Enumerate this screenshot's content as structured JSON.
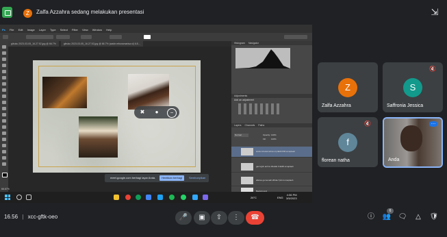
{
  "top_bar": {
    "presenter_initial": "Z",
    "presenter_text": "Zalfa Azzahra sedang melakukan presentasi",
    "collapse_icon": "collapse-icon"
  },
  "shared_screen": {
    "photoshop": {
      "menu": [
        "File",
        "Edit",
        "Image",
        "Layer",
        "Type",
        "Select",
        "Filter",
        "View",
        "Window",
        "Help"
      ],
      "tabs": [
        "gibuku 2023-03-05_16.27.52.jpg @ 66.7%",
        "gibuku 2023-03-05_16.27.52.jpg @ 66.7% (wade.rebussmarisa.sl) 6.8...",
        "gibuku 2023-03-05_16.27.52.jpg @ 66.7% (grade-rebussmarisa-sl) 6.8 CE OPP plaisle(f)... 2023-08-00"
      ],
      "zoom_readout": "66.67%",
      "panels": {
        "histogram_tabs": [
          "Histogram",
          "Navigator"
        ],
        "adjustments_title": "Adjustments",
        "adjustments_sub": "Add an adjustment",
        "layer_tabs": [
          "Layers",
          "Channels",
          "Paths"
        ],
        "blend_mode": "Normal",
        "opacity_label": "Opacity:",
        "opacity_value": "100%",
        "fill_label": "Fill:",
        "fill_value": "100%",
        "layers": [
          {
            "name": "anda rebussmarisa sl p4E4CNM.smaplaeb"
          },
          {
            "name": "gamvgzk anhra 1DeEE.7cE3M.smaplaeb"
          },
          {
            "name": "allarsa gumenadi sB4aL7p4mt.smaplaeb"
          },
          {
            "name": "Background"
          }
        ]
      }
    },
    "notification": {
      "text": "meet.google.com berbagi layar Anda.",
      "stop_button": "Hentikan berbagi",
      "hide_link": "Sembunyikan"
    },
    "taskbar": {
      "weather": "26°C",
      "lang": "ENG",
      "time": "4:36 PM",
      "date": "3/5/2023"
    }
  },
  "participants": [
    {
      "name": "Zalfa Azzahra",
      "initial": "Z",
      "color": "#e8710a",
      "muted": false
    },
    {
      "name": "Saffronia Jessica",
      "initial": "S",
      "color": "#129a8c",
      "muted": true
    },
    {
      "name": "florean natha",
      "initial": "f",
      "color": "#5f8699",
      "muted": true
    },
    {
      "name": "Anda",
      "initial": "",
      "color": "",
      "muted": false,
      "video": true
    }
  ],
  "bottom_bar": {
    "time": "16.56",
    "meeting_code": "xcc-gftk-oeo",
    "people_count": "6"
  },
  "colors": {
    "background": "#202124",
    "tile": "#3c4043",
    "end_call": "#ea4335",
    "accent": "#8ab4f8"
  }
}
